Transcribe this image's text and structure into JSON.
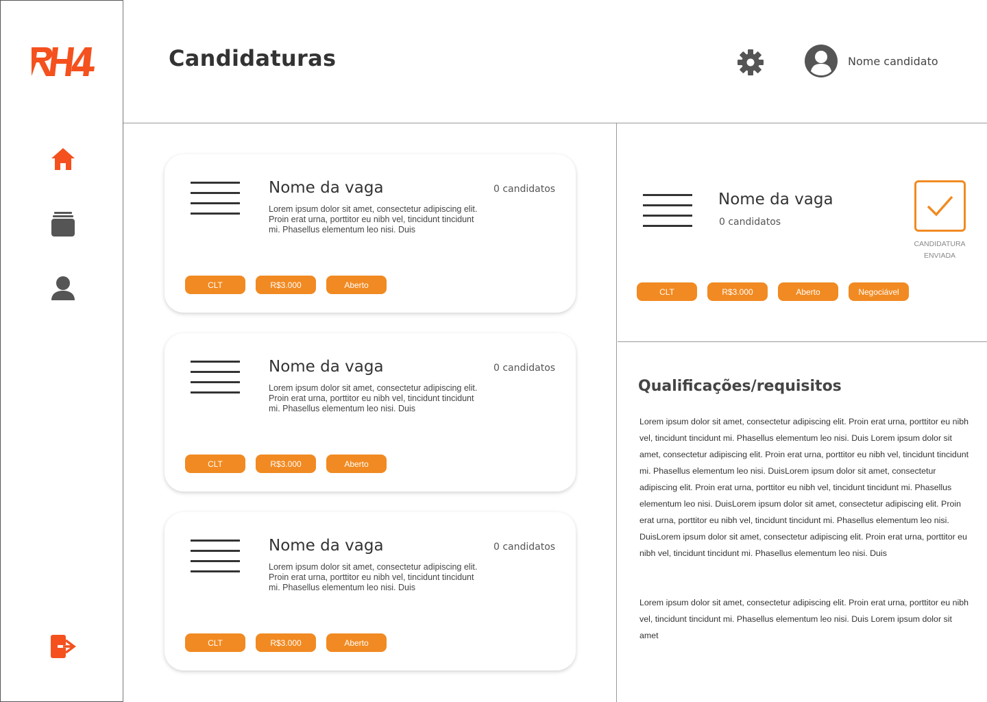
{
  "app": {
    "brand": "RH4",
    "brand_color": "#f4511e",
    "accent_color": "#f18a22"
  },
  "sidebar": {
    "items": [
      {
        "icon": "home-icon",
        "active": true
      },
      {
        "icon": "folder-icon",
        "active": false
      },
      {
        "icon": "user-icon",
        "active": false
      }
    ],
    "logout_icon": "logout-icon"
  },
  "header": {
    "title": "Candidaturas",
    "user_name": "Nome candidato"
  },
  "jobs": [
    {
      "title": "Nome da vaga",
      "count": "0 candidatos",
      "description": "Lorem ipsum dolor sit amet, consectetur adipiscing elit. Proin erat urna, porttitor eu nibh vel, tincidunt tincidunt mi. Phasellus elementum leo nisi. Duis",
      "tags": [
        "CLT",
        "R$3.000",
        "Aberto"
      ]
    },
    {
      "title": "Nome da vaga",
      "count": "0 candidatos",
      "description": "Lorem ipsum dolor sit amet, consectetur adipiscing elit. Proin erat urna, porttitor eu nibh vel, tincidunt tincidunt mi. Phasellus elementum leo nisi. Duis",
      "tags": [
        "CLT",
        "R$3.000",
        "Aberto"
      ]
    },
    {
      "title": "Nome da vaga",
      "count": "0 candidatos",
      "description": "Lorem ipsum dolor sit amet, consectetur adipiscing elit. Proin erat urna, porttitor eu nibh vel, tincidunt tincidunt mi. Phasellus elementum leo nisi. Duis",
      "tags": [
        "CLT",
        "R$3.000",
        "Aberto"
      ]
    }
  ],
  "detail": {
    "title": "Nome da vaga",
    "count": "0 candidatos",
    "status_label_line1": "CANDIDATURA",
    "status_label_line2": "ENVIADA",
    "tags": [
      "CLT",
      "R$3.000",
      "Aberto",
      "Negociável"
    ],
    "section_title": "Qualificações/requisitos",
    "paragraph1": "Lorem ipsum dolor sit amet, consectetur adipiscing elit. Proin erat urna, porttitor eu nibh vel, tincidunt tincidunt mi. Phasellus elementum leo nisi. Duis Lorem ipsum dolor sit amet, consectetur adipiscing elit. Proin erat urna, porttitor eu nibh vel, tincidunt tincidunt mi. Phasellus elementum leo nisi. DuisLorem ipsum dolor sit amet, consectetur adipiscing elit. Proin erat urna, porttitor eu nibh vel, tincidunt tincidunt mi. Phasellus elementum leo nisi. DuisLorem ipsum dolor sit amet, consectetur adipiscing elit. Proin erat urna, porttitor eu nibh vel, tincidunt tincidunt mi. Phasellus elementum leo nisi. DuisLorem ipsum dolor sit amet, consectetur adipiscing elit. Proin erat urna, porttitor eu nibh vel, tincidunt tincidunt mi. Phasellus elementum leo nisi. Duis",
    "paragraph2": "Lorem ipsum dolor sit amet, consectetur adipiscing elit. Proin erat urna, porttitor eu nibh vel, tincidunt tincidunt mi. Phasellus elementum leo nisi. Duis Lorem ipsum dolor sit amet"
  }
}
